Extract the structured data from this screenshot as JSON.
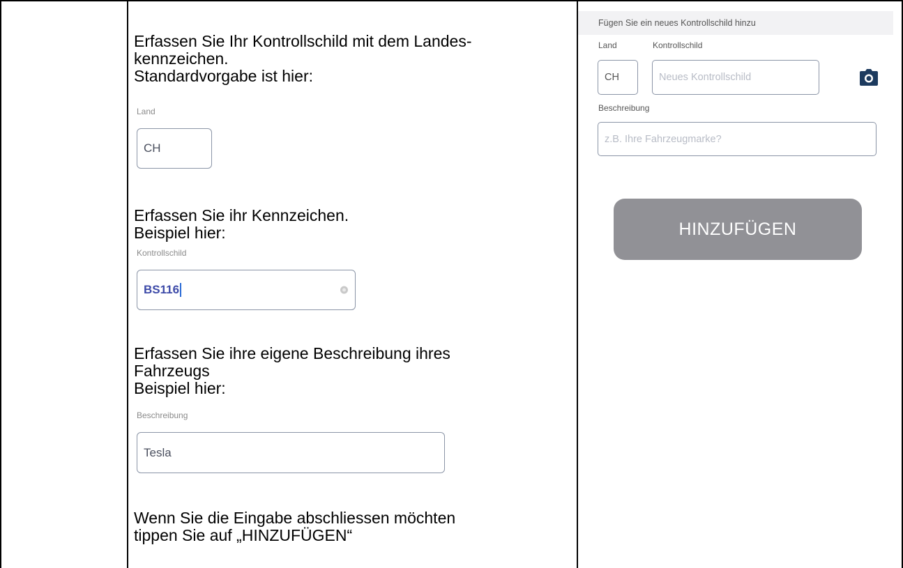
{
  "doc": {
    "step1_line1": "Erfassen Sie Ihr Kontrollschild mit dem Landes-",
    "step1_line2": "kennzeichen.",
    "step1_line3": "Standardvorgabe ist hier:",
    "example_land_label": "Land",
    "example_land_value": "CH",
    "step2_line1": "Erfassen Sie ihr Kennzeichen.",
    "step2_line2": "Beispiel hier:",
    "example_plate_label": "Kontrollschild",
    "example_plate_value": "BS116",
    "step3_line1": "Erfassen Sie ihre eigene Beschreibung ihres",
    "step3_line2": "Fahrzeugs",
    "step3_line3": "Beispiel hier:",
    "example_desc_label": "Beschreibung",
    "example_desc_value": "Tesla",
    "step4_line1": "Wenn Sie die Eingabe abschliessen möchten",
    "step4_line2": "tippen Sie auf „HINZUFÜGEN“"
  },
  "app": {
    "header": "Fügen Sie ein neues Kontrollschild hinzu",
    "land_label": "Land",
    "land_value": "CH",
    "plate_label": "Kontrollschild",
    "plate_placeholder": "Neues Kontrollschild",
    "desc_label": "Beschreibung",
    "desc_placeholder": "z.B. Ihre Fahrzeugmarke?",
    "add_button": "HINZUFÜGEN",
    "camera_icon": "camera-icon",
    "button_color": "#919196",
    "camera_color": "#1c3a5e"
  }
}
